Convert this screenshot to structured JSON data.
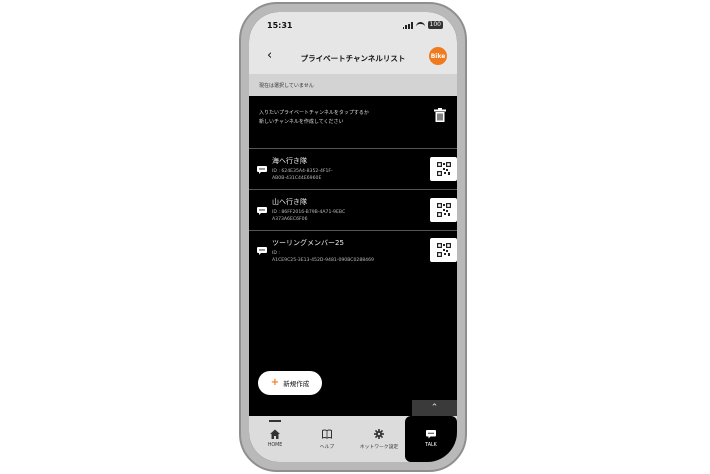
{
  "status": {
    "time": "15:31",
    "battery": "100"
  },
  "header": {
    "title": "プライベートチャンネルリスト",
    "logo_text": "Bike"
  },
  "notice": "現在は選択していません",
  "instructions": {
    "line1": "入りたいプライベートチャンネルをタップするか",
    "line2": "新しいチャンネルを作成してください"
  },
  "channels": [
    {
      "name": "海へ行き隊",
      "id_line1": "ID : 624E35A4-8352-4F1F-",
      "id_line2": "AB0B-431C44E6960E"
    },
    {
      "name": "山へ行き隊",
      "id_line1": "ID : 86FF2016-B79B-4A71-9EBC",
      "id_line2": "A373A6EC6F06"
    },
    {
      "name": "ツーリングメンバー25",
      "id_line1": "ID :",
      "id_line2": "A1CE9C25-3E13-452D-9481-090BC0288469"
    }
  ],
  "new_button": "新規作成",
  "tabs": [
    {
      "label": "HOME",
      "icon": "home-icon"
    },
    {
      "label": "ヘルプ",
      "icon": "help-book-icon"
    },
    {
      "label": "ネットワーク設定",
      "icon": "settings-gear-icon"
    },
    {
      "label": "TALK",
      "icon": "talk-bubble-icon"
    }
  ],
  "colors": {
    "accent": "#f07a1e",
    "screen_bg": "#000000",
    "bar_bg": "#e6e6e6"
  }
}
